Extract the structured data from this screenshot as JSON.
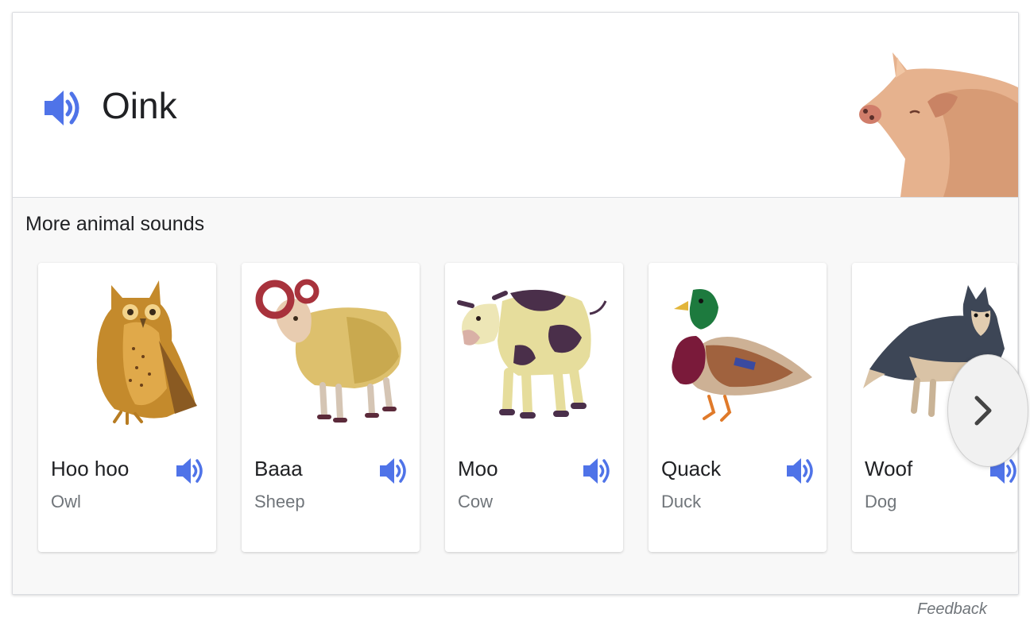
{
  "hero": {
    "sound": "Oink",
    "speaker_icon": "speaker-icon",
    "animal_icon": "pig-illustration"
  },
  "section_title": "More animal sounds",
  "animals": [
    {
      "sound": "Hoo hoo",
      "name": "Owl",
      "icon": "owl-illustration"
    },
    {
      "sound": "Baaa",
      "name": "Sheep",
      "icon": "sheep-illustration"
    },
    {
      "sound": "Moo",
      "name": "Cow",
      "icon": "cow-illustration"
    },
    {
      "sound": "Quack",
      "name": "Duck",
      "icon": "duck-illustration"
    },
    {
      "sound": "Woof",
      "name": "Dog",
      "icon": "dog-illustration"
    }
  ],
  "next_icon": "chevron-right-icon",
  "feedback": "Feedback",
  "colors": {
    "speaker": "#4f73e8",
    "text_primary": "#202124",
    "text_secondary": "#70757a",
    "section_bg": "#f8f8f8"
  }
}
